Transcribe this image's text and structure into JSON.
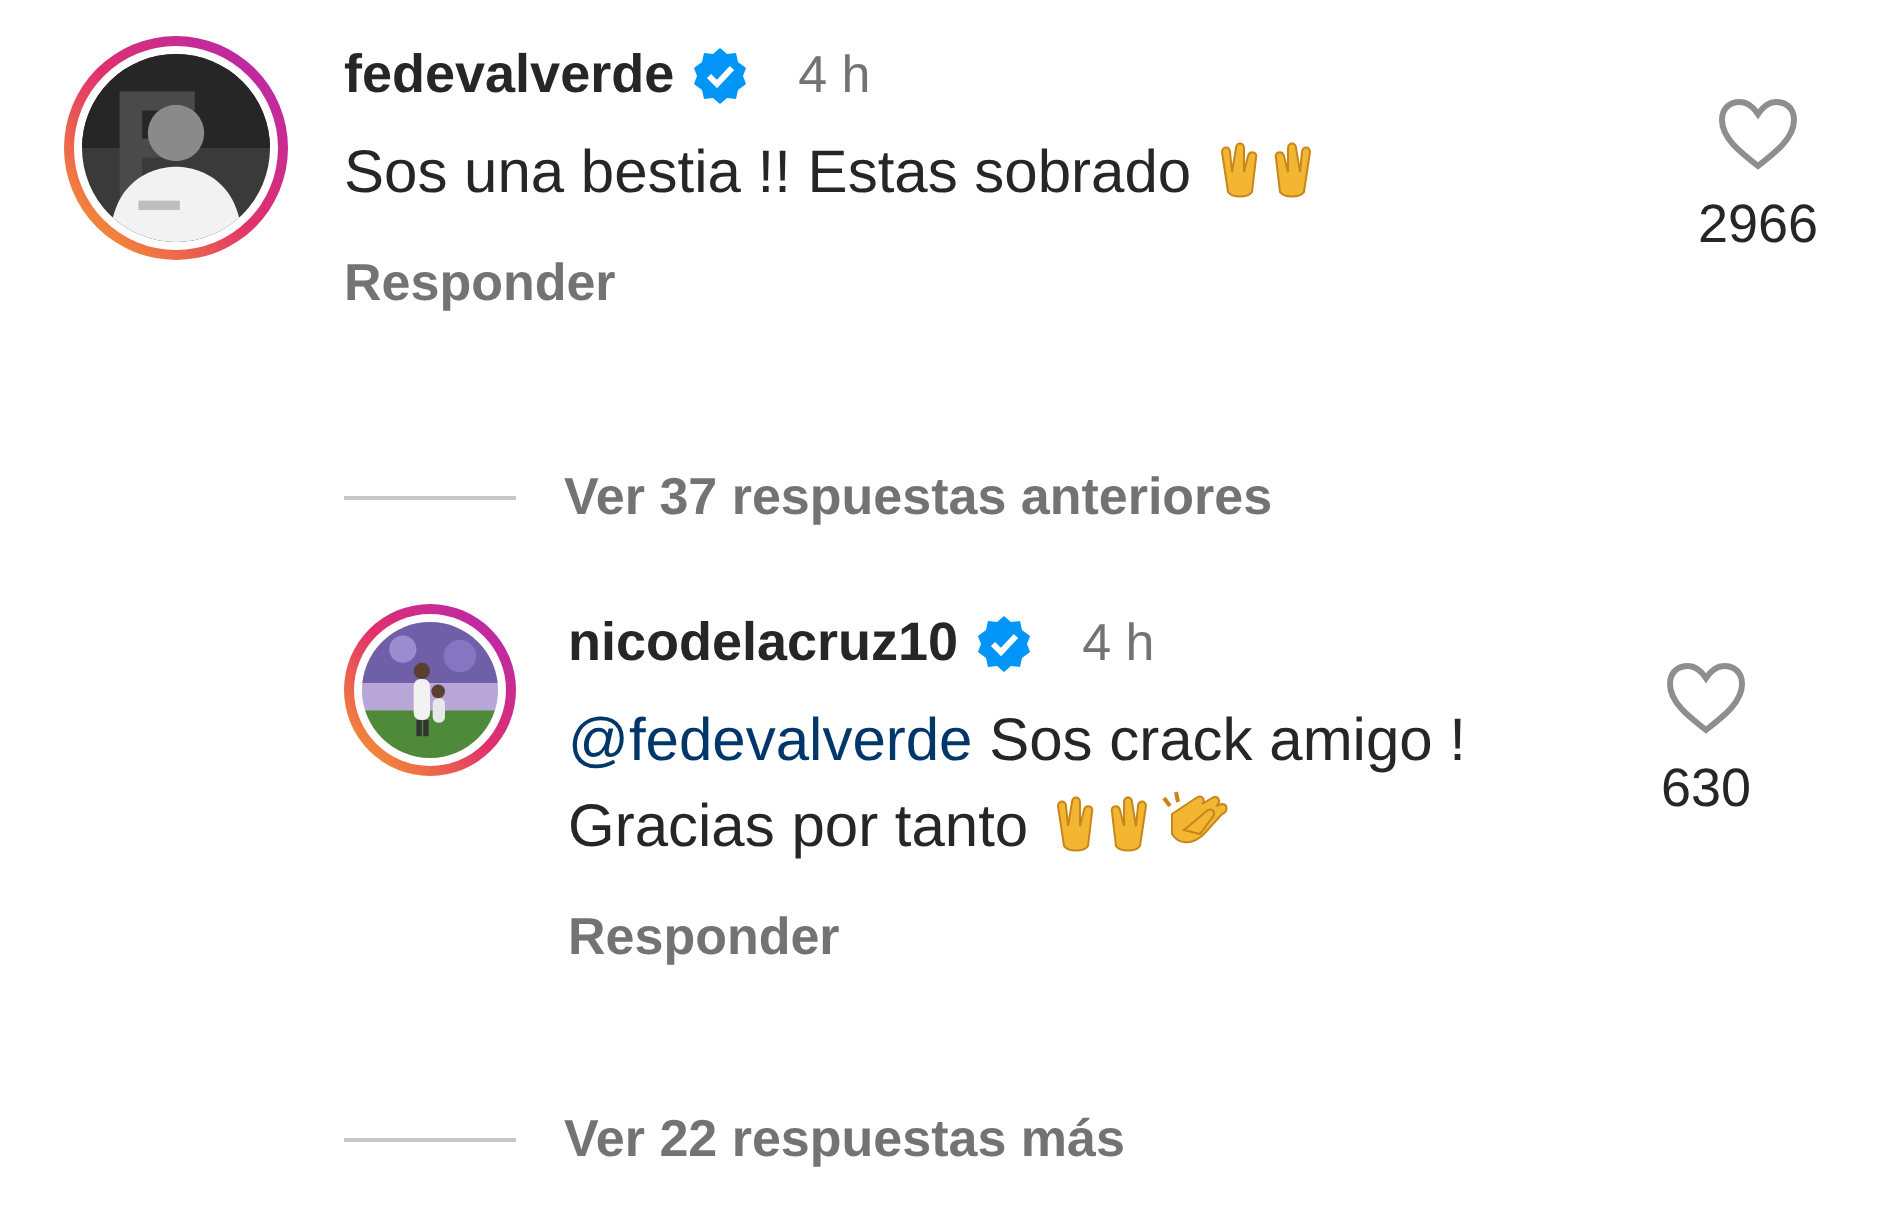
{
  "comments": [
    {
      "username": "fedevalverde",
      "verified": true,
      "time": "4 h",
      "text": "Sos una bestia !! Estas sobrado",
      "emoji": [
        {
          "kind": "raised-hands"
        }
      ],
      "likes": "2966",
      "reply_label": "Responder",
      "liked": false
    },
    {
      "thread_label": "Ver 37 respuestas anteriores",
      "kind": "thread"
    },
    {
      "username": "nicodelacruz10",
      "verified": true,
      "time": "4 h",
      "mention": "@fedevalverde",
      "text": "Sos crack amigo ! Gracias por tanto",
      "emoji": [
        {
          "kind": "raised-hands"
        },
        {
          "kind": "clapping-hands"
        }
      ],
      "likes": "630",
      "reply_label": "Responder",
      "liked": false,
      "kind": "reply"
    },
    {
      "thread_label": "Ver 22 respuestas más",
      "kind": "thread"
    }
  ]
}
